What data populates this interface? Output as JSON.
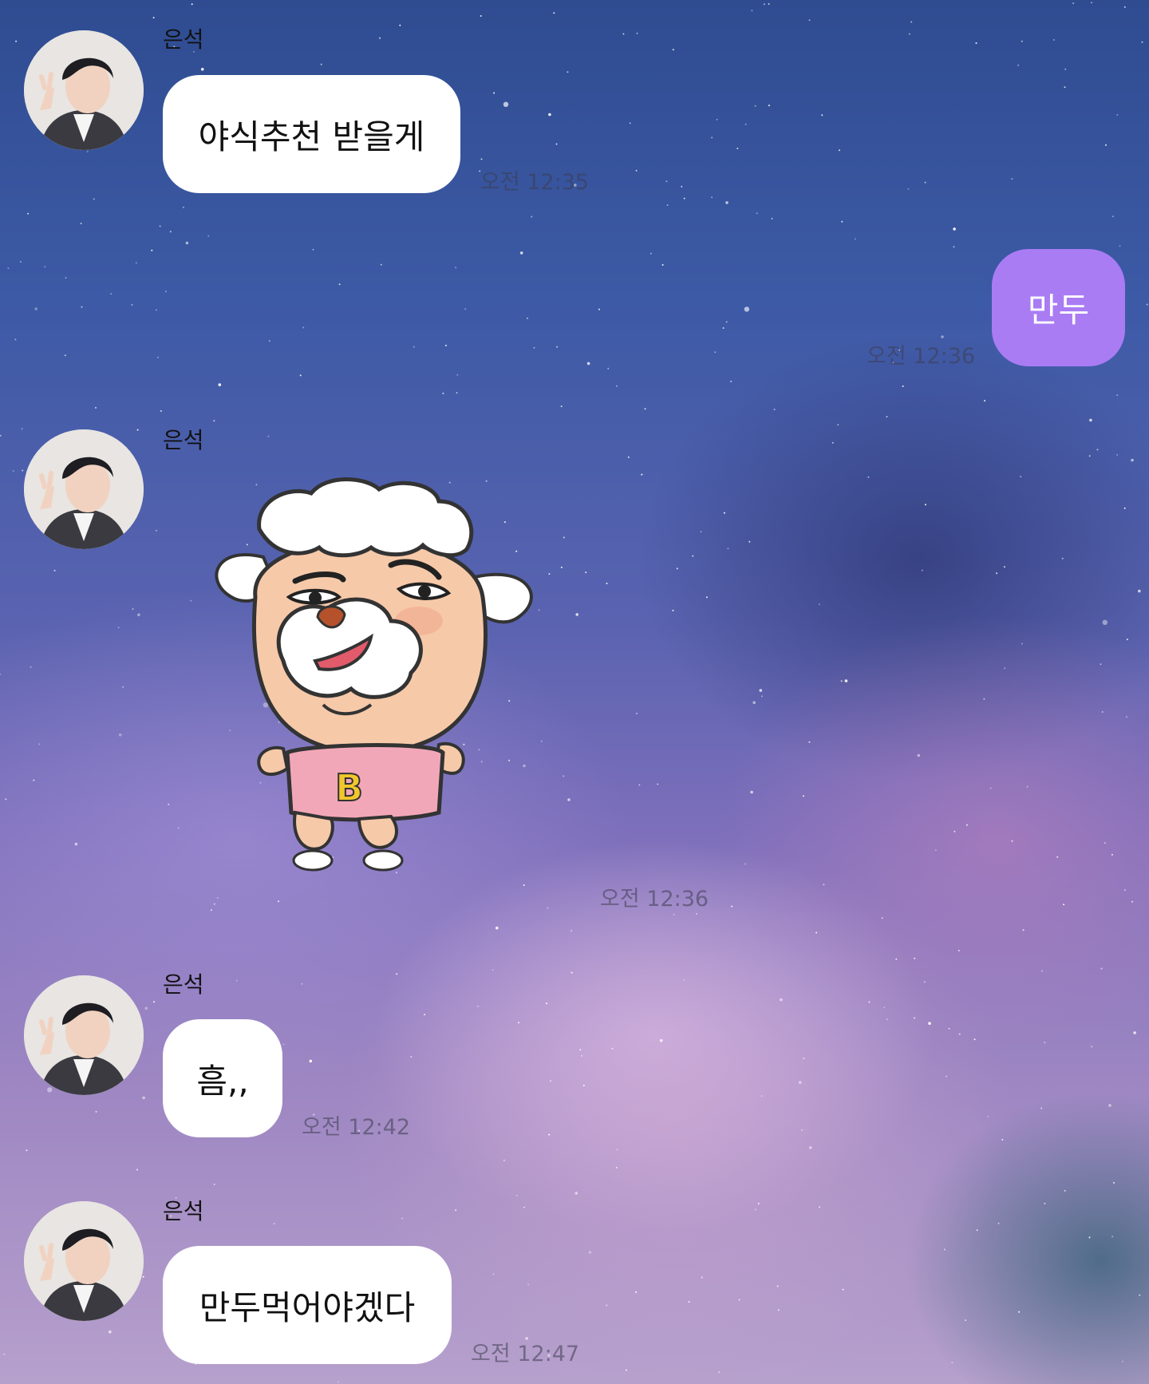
{
  "chat": {
    "messages": [
      {
        "sender": "은석",
        "text": "야식추천 받을게",
        "time": "오전 12:35"
      },
      {
        "sender": "me",
        "text": "만두",
        "time": "오전 12:36"
      },
      {
        "sender": "은석",
        "sticker": "sheep-sticker",
        "time": "오전 12:36"
      },
      {
        "sender": "은석",
        "text": "흠,,",
        "time": "오전 12:42"
      },
      {
        "sender": "은석",
        "text": "만두먹어야겠다",
        "time": "오전 12:47"
      }
    ]
  },
  "colors": {
    "my_bubble": "#a97cf4",
    "their_bubble": "#ffffff",
    "sticker_shirt": "#f2a7b8",
    "sticker_letter": "#f2c62c"
  },
  "sticker": {
    "shirt_letter": "B"
  }
}
